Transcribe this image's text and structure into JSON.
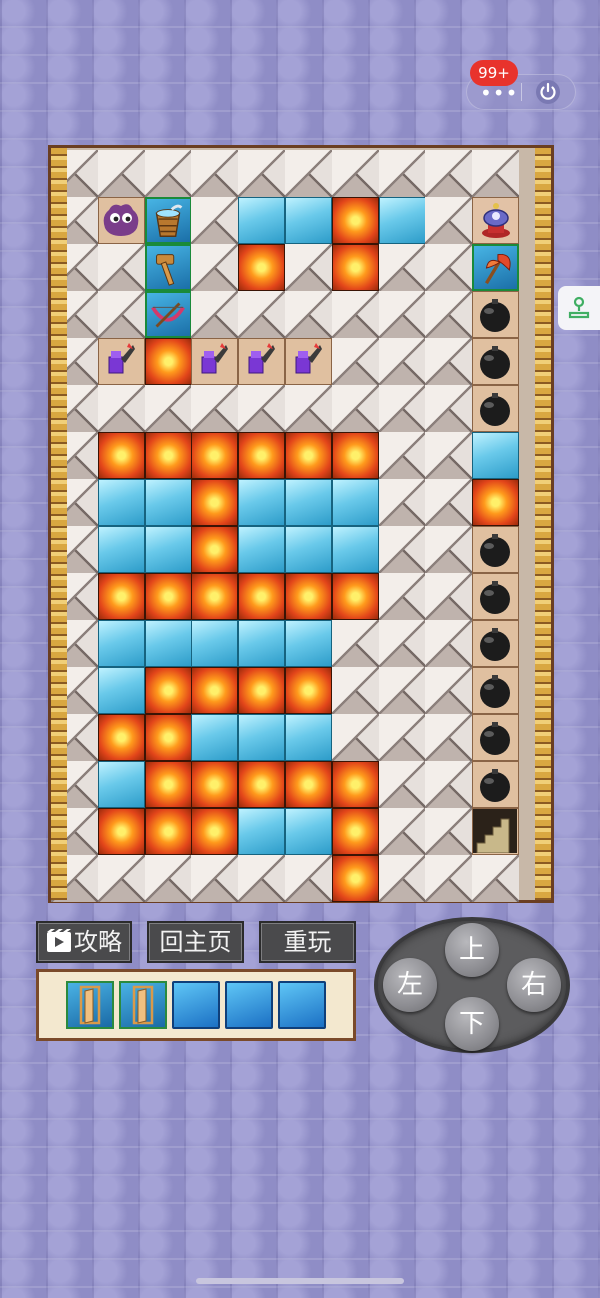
{
  "status": {
    "badge": "99+",
    "more_icon": "more-dots-icon",
    "power_icon": "power-icon"
  },
  "side_tab": {
    "icon": "gamepad-icon"
  },
  "board": {
    "cols": 10,
    "rows": 16,
    "legend": {
      "S": "spike",
      "L": "lava",
      "I": "ice",
      "M": "monster",
      "B": "bucket",
      "H": "hammer",
      "X": "crossbow",
      "P": "player-gem",
      "E": "axe",
      "O": "bomb",
      "T": "purple-torch",
      "D": "exit-stairs"
    },
    "grid": [
      "SSSSSSSSSS",
      "SMBSIILISP",
      "SSHSLSLSSE",
      "SSXSSSSSSO",
      "STLTTTSSSO",
      "SSSSSSSSSO",
      "SLLLLLLSSI",
      "SIILIIISSL",
      "SIILIIISSO",
      "SLLLLLLSSO",
      "SIIIIISSSO",
      "SILLLLSSSO",
      "SLLIIISSSO",
      "SILLLLLSSO",
      "SLLLIILSSD",
      "SSSSSSLSSS"
    ]
  },
  "buttons": {
    "guide": "攻略",
    "home": "回主页",
    "replay": "重玩"
  },
  "inventory": {
    "slots": [
      "door",
      "door",
      "box",
      "box",
      "box"
    ]
  },
  "dpad": {
    "up": "上",
    "left": "左",
    "right": "右",
    "down": "下"
  }
}
